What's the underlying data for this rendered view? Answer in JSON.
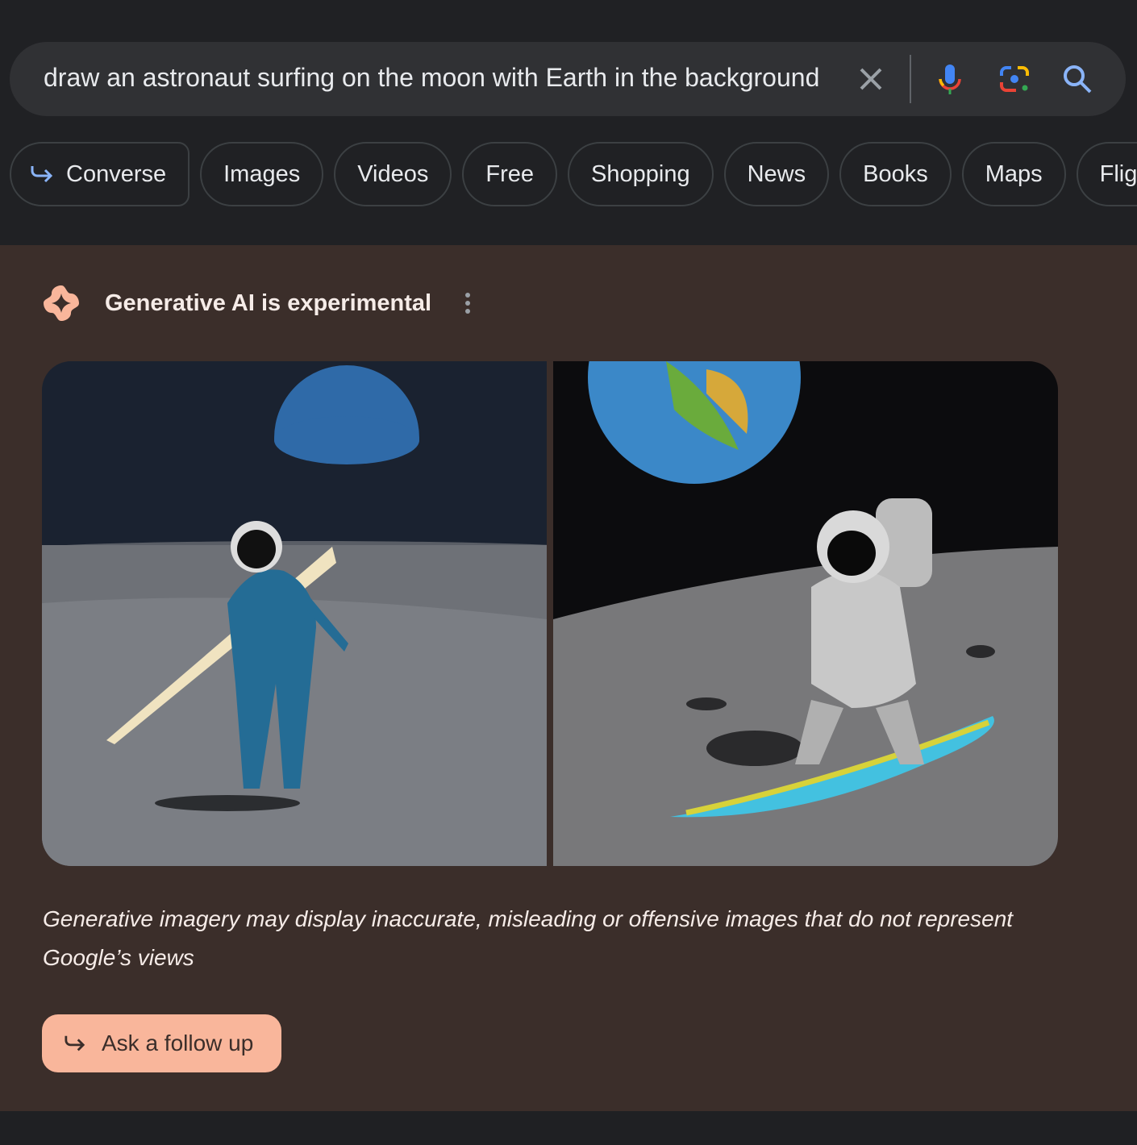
{
  "search": {
    "query": "draw an astronaut surfing on the moon with Earth in the background",
    "icons": [
      "close-icon",
      "microphone-icon",
      "google-lens-icon",
      "search-icon"
    ]
  },
  "chips": [
    {
      "label": "Converse",
      "icon": "arrow-return-icon"
    },
    {
      "label": "Images"
    },
    {
      "label": "Videos"
    },
    {
      "label": "Free"
    },
    {
      "label": "Shopping"
    },
    {
      "label": "News"
    },
    {
      "label": "Books"
    },
    {
      "label": "Maps"
    },
    {
      "label": "Flights"
    }
  ],
  "ai": {
    "title": "Generative AI is experimental",
    "icon": "sparkle-icon",
    "disclaimer": "Generative imagery may display inaccurate, misleading or offensive images that do not represent Google’s views",
    "follow_up": "Ask a follow up",
    "accent": "#f9b69b",
    "background": "#3b2e2a"
  }
}
